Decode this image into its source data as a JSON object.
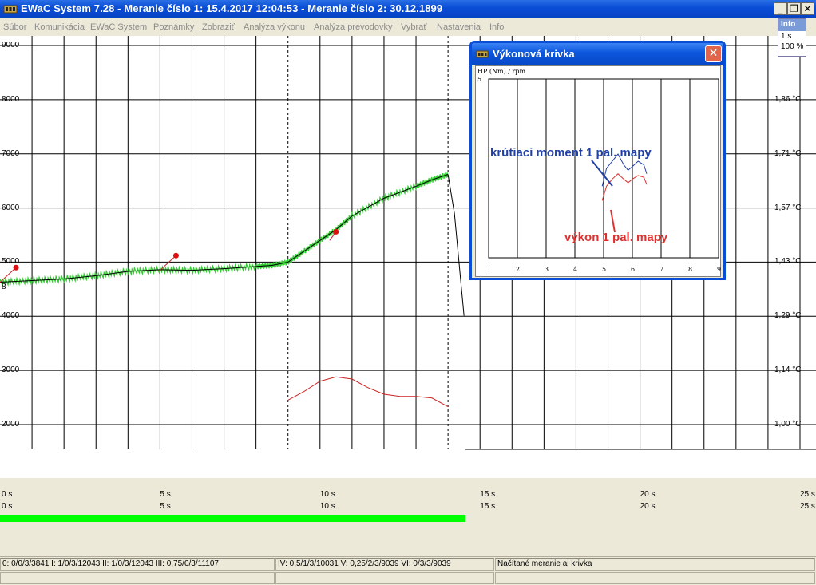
{
  "window": {
    "title": "EWaC System 7.28 - Meranie číslo 1: 15.4.2017 12:04:53 - Meranie číslo 2: 30.12.1899",
    "minimize_label": "_",
    "restore_label": "❐",
    "close_label": "✕"
  },
  "menu": [
    "Súbor",
    "Komunikácia",
    "EWaC System",
    "Poznámky",
    "Zobraziť",
    "Analýza výkonu",
    "Analýza prevodovky",
    "Vybrať",
    "Nastavenia",
    "Info"
  ],
  "info_box": {
    "title": "Info",
    "interval": "1 s",
    "zoom": "100 %"
  },
  "chart_data": {
    "type": "line",
    "left_axis_ticks": [
      "9000",
      "8000",
      "7000",
      "6000",
      "5000",
      "4000",
      "3000",
      "2000"
    ],
    "left_axis_range": [
      2000,
      9000
    ],
    "right_axis_ticks": [
      "1,86 °C",
      "1,71 °C",
      "1,57 °C",
      "1,43 °C",
      "1,29 °C",
      "1,14 °C",
      "1,00 °C"
    ],
    "right_axis_range": [
      1.0,
      1.86
    ],
    "x_ticks": [
      "0 s",
      "5 s",
      "10 s",
      "15 s",
      "20 s",
      "25 s"
    ],
    "x_range": [
      0,
      25
    ],
    "marker_label": "8",
    "series": [
      {
        "color": "#33cc33",
        "x": [
          0,
          1,
          2,
          3,
          4,
          5,
          6,
          7,
          8,
          8.5,
          9,
          9.5,
          10,
          10.5,
          11,
          12,
          13,
          13.5,
          14
        ],
        "y": [
          4630,
          4660,
          4690,
          4750,
          4830,
          4860,
          4850,
          4880,
          4920,
          4940,
          5000,
          5200,
          5400,
          5600,
          5850,
          6180,
          6400,
          6520,
          6620
        ]
      },
      {
        "color": "#000000",
        "x": [
          14,
          14.2,
          14.5
        ],
        "y": [
          6620,
          5900,
          4010
        ]
      },
      {
        "color": "#cc2222",
        "x": [
          9,
          9.5,
          10,
          10.5,
          11,
          11.5,
          12,
          12.5,
          13,
          13.5,
          14
        ],
        "y": [
          2450,
          2610,
          2800,
          2880,
          2840,
          2680,
          2560,
          2520,
          2520,
          2490,
          2330
        ]
      }
    ],
    "markers": [
      {
        "x": 0.5,
        "y": 4900
      },
      {
        "x": 5.5,
        "y": 5120
      },
      {
        "x": 10.5,
        "y": 5560
      }
    ],
    "progress": 0.57
  },
  "dialog": {
    "title": "Výkonová krivka",
    "close_label": "✕",
    "ylabel": "HP (Nm) / rpm",
    "ymax": "5",
    "x_ticks": [
      "1",
      "2",
      "3",
      "4",
      "5",
      "6",
      "7",
      "8",
      "9"
    ],
    "x_range": [
      1,
      9
    ],
    "y_range": [
      0,
      5
    ],
    "torque_label": "krútiaci moment 1 pal. mapy",
    "power_label": "výkon 1 pal. mapy",
    "torque_color": "#2140a5",
    "power_color": "#e03030",
    "torque_curve": {
      "x": [
        4.95,
        5.1,
        5.3,
        5.5,
        5.7,
        5.85,
        6.0,
        6.2,
        6.4,
        6.5
      ],
      "y": [
        2.0,
        2.5,
        2.7,
        2.9,
        2.6,
        2.45,
        2.55,
        2.7,
        2.6,
        2.35
      ]
    },
    "power_curve": {
      "x": [
        4.95,
        5.1,
        5.3,
        5.5,
        5.7,
        5.85,
        6.0,
        6.2,
        6.4,
        6.5
      ],
      "y": [
        1.6,
        2.0,
        2.2,
        2.35,
        2.2,
        2.1,
        2.2,
        2.3,
        2.25,
        2.05
      ]
    }
  },
  "status": {
    "panel1": "0: 0/0/3/3841  I: 1/0/3/12043  II: 1/0/3/12043  III: 0,75/0/3/11107",
    "panel2": "IV: 0,5/1/3/10031  V: 0,25/2/3/9039  VI: 0/3/3/9039",
    "panel3": "Načítané meranie aj krivka"
  }
}
